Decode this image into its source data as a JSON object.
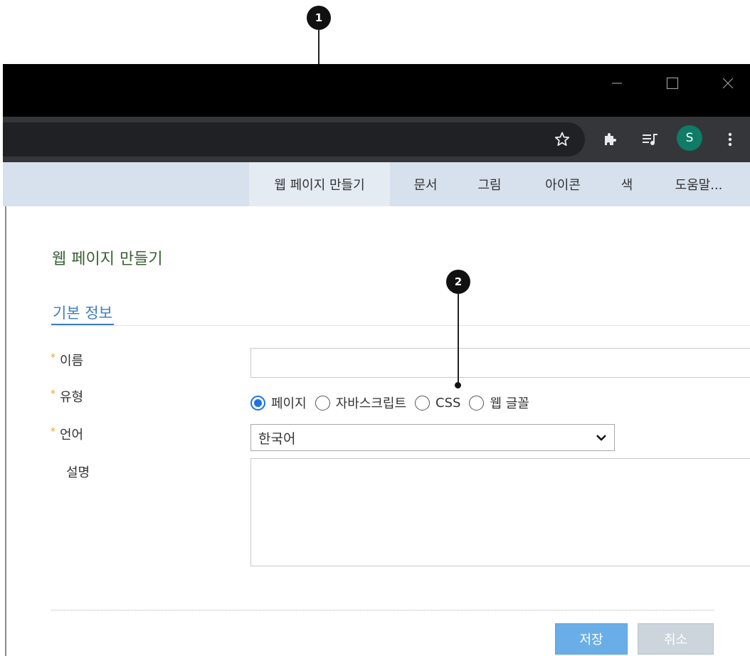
{
  "callouts": [
    {
      "number": "1"
    },
    {
      "number": "2"
    }
  ],
  "window_controls": {
    "minimize_icon": "minimize-icon",
    "maximize_icon": "maximize-icon",
    "close_icon": "close-icon"
  },
  "browser_toolbar": {
    "icons": [
      "star-icon",
      "puzzle-extension-icon",
      "media-queue-icon",
      "overflow-menu-icon"
    ],
    "profile_initial": "S",
    "profile_color": "#0e7c66"
  },
  "app_nav": {
    "items": [
      {
        "label": "웹 페이지 만들기",
        "active": true
      },
      {
        "label": "문서"
      },
      {
        "label": "그림"
      },
      {
        "label": "아이콘"
      },
      {
        "label": "색"
      },
      {
        "label": "도움말..."
      }
    ]
  },
  "form": {
    "title": "웹 페이지 만들기",
    "section_tab": "기본 정보",
    "required_mark": "*",
    "name": {
      "label": "이름",
      "value": ""
    },
    "type": {
      "label": "유형",
      "options": [
        "페이지",
        "자바스크립트",
        "CSS",
        "웹 글꼴"
      ],
      "selected": "페이지"
    },
    "language": {
      "label": "언어",
      "value": "한국어"
    },
    "description": {
      "label": "설명",
      "value": ""
    },
    "save_label": "저장",
    "cancel_label": "취소"
  },
  "colors": {
    "accent": "#3d7ec2",
    "title_green": "#3a5f35",
    "required": "#f0a030",
    "save_button": "#6aaee8",
    "cancel_button": "#ccd4dc",
    "nav_bar": "#d7e1ed"
  }
}
